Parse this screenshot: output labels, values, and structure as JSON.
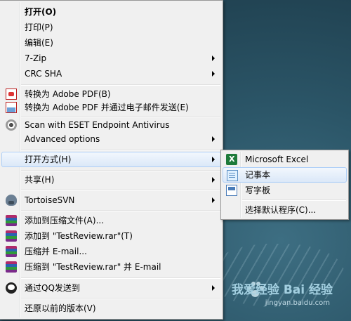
{
  "menu": {
    "items": [
      {
        "label": "打开(O)"
      },
      {
        "label": "打印(P)"
      },
      {
        "label": "编辑(E)"
      },
      {
        "label": "7-Zip"
      },
      {
        "label": "CRC SHA"
      },
      {
        "label": "转换为 Adobe PDF(B)"
      },
      {
        "label": "转换为 Adobe PDF 并通过电子邮件发送(E)"
      },
      {
        "label": "Scan with ESET Endpoint Antivirus"
      },
      {
        "label": "Advanced options"
      },
      {
        "label": "打开方式(H)"
      },
      {
        "label": "共享(H)"
      },
      {
        "label": "TortoiseSVN"
      },
      {
        "label": "添加到压缩文件(A)..."
      },
      {
        "label": "添加到 \"TestReview.rar\"(T)"
      },
      {
        "label": "压缩并 E-mail..."
      },
      {
        "label": "压缩到 \"TestReview.rar\" 并 E-mail"
      },
      {
        "label": "通过QQ发送到"
      },
      {
        "label": "还原以前的版本(V)"
      }
    ]
  },
  "submenu": {
    "items": [
      {
        "label": "Microsoft Excel"
      },
      {
        "label": "记事本"
      },
      {
        "label": "写字板"
      },
      {
        "label": "选择默认程序(C)..."
      }
    ]
  },
  "watermark": {
    "main": "我爱经验 Bai 经验",
    "sub": "jingyan.baidu.com"
  },
  "colors": {
    "menu_bg": "#f0f0f0",
    "hover_border": "#aecff7",
    "desktop": "#2a4b5a"
  }
}
